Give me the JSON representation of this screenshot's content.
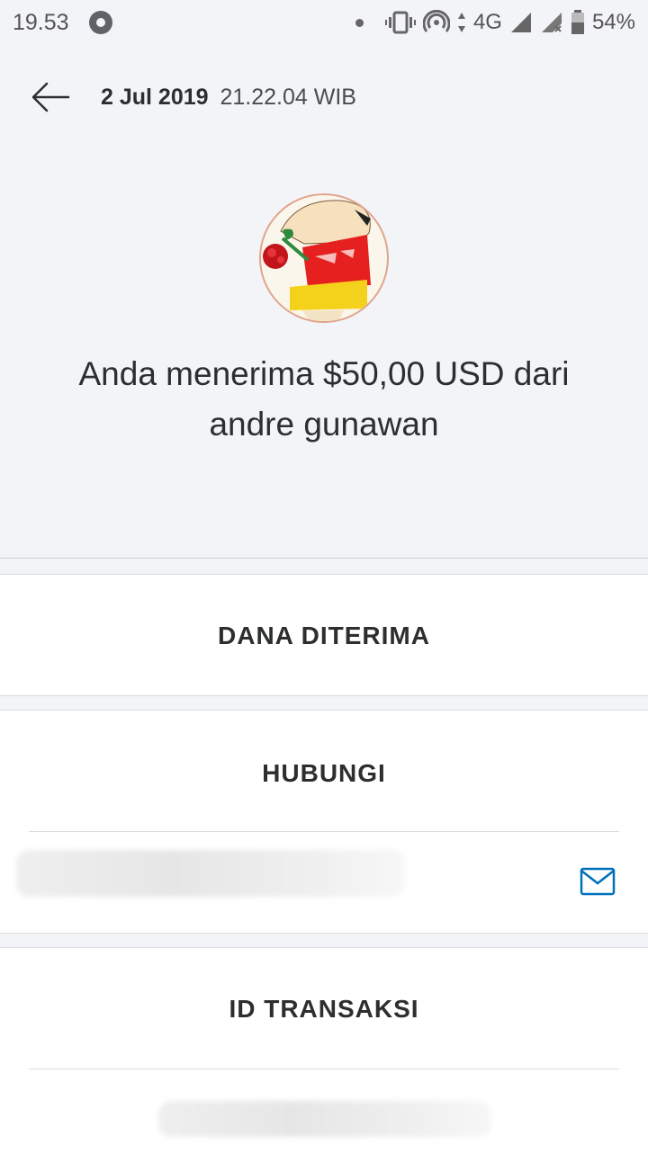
{
  "status_bar": {
    "time": "19.53",
    "network": "4G",
    "battery": "54%"
  },
  "header": {
    "date": "2 Jul 2019",
    "time": "21.22.04 WIB"
  },
  "transaction": {
    "headline": "Anda menerima $50,00 USD dari andre gunawan"
  },
  "sections": {
    "funds_title": "DANA DITERIMA",
    "contact_title": "HUBUNGI",
    "transaction_id_title": "ID TRANSAKSI"
  },
  "colors": {
    "background": "#f3f4f8",
    "card": "#ffffff",
    "text": "#2c2e2f",
    "accent": "#0070ba"
  },
  "icons": {
    "back": "arrow-left-icon",
    "mail": "mail-icon"
  }
}
